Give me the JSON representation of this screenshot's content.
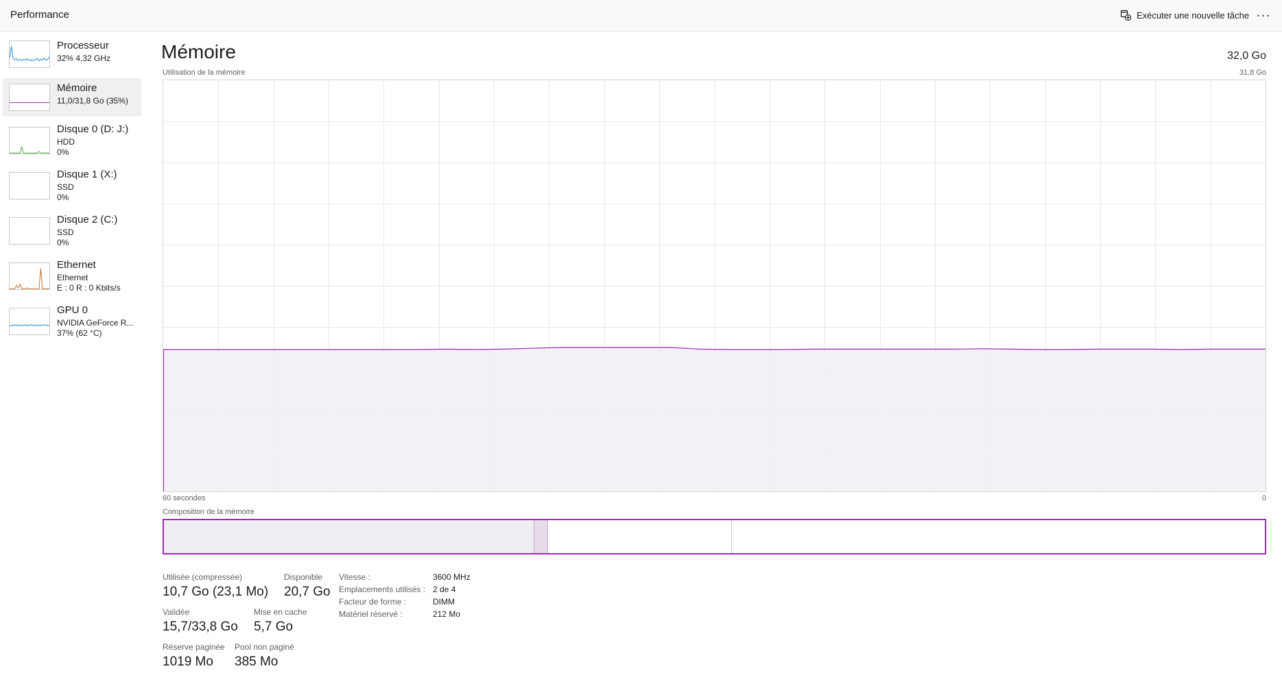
{
  "header": {
    "title": "Performance",
    "new_task_label": "Exécuter une nouvelle tâche",
    "more_label": "···"
  },
  "sidebar": {
    "items": [
      {
        "name": "Processeur",
        "sub1": "32% 4,32 GHz",
        "sub2": ""
      },
      {
        "name": "Mémoire",
        "sub1": "11,0/31,8 Go (35%)",
        "sub2": ""
      },
      {
        "name": "Disque 0 (D: J:)",
        "sub1": "HDD",
        "sub2": "0%"
      },
      {
        "name": "Disque 1 (X:)",
        "sub1": "SSD",
        "sub2": "0%"
      },
      {
        "name": "Disque 2 (C:)",
        "sub1": "SSD",
        "sub2": "0%"
      },
      {
        "name": "Ethernet",
        "sub1": "Ethernet",
        "sub2": "E : 0 R : 0 Kbits/s"
      },
      {
        "name": "GPU 0",
        "sub1": "NVIDIA GeForce R...",
        "sub2": "37% (62 °C)"
      }
    ]
  },
  "main": {
    "title": "Mémoire",
    "total": "32,0 Go",
    "usage_label": "Utilisation de la mémoire",
    "usage_max": "31,8 Go",
    "time_label_left": "60 secondes",
    "time_label_right": "0",
    "composition_label": "Composition de la mémoire",
    "usage_history_pct": [
      34.5,
      34.5,
      34.5,
      34.5,
      34.5,
      34.5,
      34.5,
      34.5,
      34.5,
      34.5,
      34.6,
      34.5,
      34.6,
      34.8,
      35.0,
      35.0,
      35.0,
      35.0,
      35.0,
      34.6,
      34.5,
      34.5,
      34.5,
      34.6,
      34.6,
      34.6,
      34.6,
      34.6,
      34.6,
      34.7,
      34.6,
      34.5,
      34.5,
      34.6,
      34.6,
      34.6,
      34.5,
      34.6,
      34.6,
      34.6
    ],
    "composition": {
      "in_use_gb": 10.7,
      "modified_gb": 0.4,
      "standby_gb": 5.3,
      "free_gb": 15.4
    },
    "stats": {
      "in_use_label": "Utilisée (compressée)",
      "in_use_value": "10,7 Go (23,1 Mo)",
      "available_label": "Disponible",
      "available_value": "20,7 Go",
      "committed_label": "Validée",
      "committed_value": "15,7/33,8 Go",
      "cached_label": "Mise en cache",
      "cached_value": "5,7 Go",
      "paged_label": "Réserve paginée",
      "paged_value": "1019 Mo",
      "nonpaged_label": "Pool non paginé",
      "nonpaged_value": "385 Mo"
    },
    "details": [
      {
        "key": "Vitesse :",
        "value": "3600 MHz"
      },
      {
        "key": "Emplacements utilisés :",
        "value": "2 de 4"
      },
      {
        "key": "Facteur de forme :",
        "value": "DIMM"
      },
      {
        "key": "Matériel réservé :",
        "value": "212 Mo"
      }
    ]
  },
  "colors": {
    "memory": "#9b2bb0",
    "memory_fill": "#f1edf4",
    "cpu": "#1c8dd9",
    "disk": "#4cab3c",
    "ethernet": "#c8702a",
    "gpu": "#1c8dd9",
    "grid": "#e8e8e8"
  }
}
